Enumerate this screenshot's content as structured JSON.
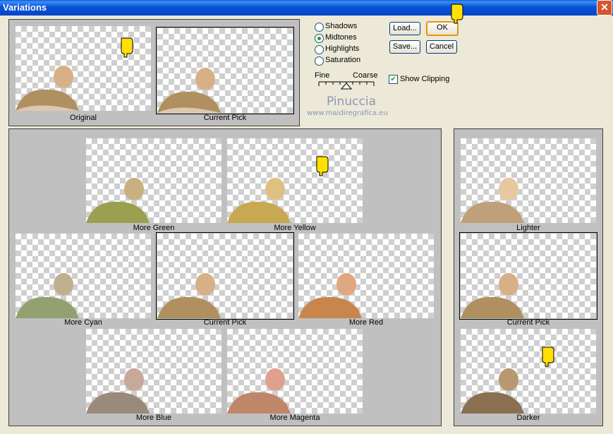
{
  "window": {
    "title": "Variations",
    "close_glyph": "✕"
  },
  "top_previews": [
    {
      "label": "Original",
      "selected": false
    },
    {
      "label": "Current Pick",
      "selected": true
    }
  ],
  "options": {
    "radios": [
      {
        "label": "Shadows",
        "checked": false
      },
      {
        "label": "Midtones",
        "checked": true
      },
      {
        "label": "Highlights",
        "checked": false
      },
      {
        "label": "Saturation",
        "checked": false
      }
    ],
    "slider": {
      "fine_label": "Fine",
      "coarse_label": "Coarse",
      "level": 0.5
    },
    "show_clipping": {
      "label": "Show Clipping",
      "checked": true
    }
  },
  "buttons": {
    "load": "Load...",
    "ok": "OK",
    "save": "Save...",
    "cancel": "Cancel"
  },
  "watermark": {
    "name": "Pinuccia",
    "url": "www.maidiregrafica.eu"
  },
  "color_variations": [
    {
      "label": "More Green",
      "tint": "#9aa050"
    },
    {
      "label": "More Yellow",
      "tint": "#c8a850"
    },
    {
      "label": "More Cyan",
      "tint": "#93a070"
    },
    {
      "label": "Current Pick",
      "tint": "#b09060",
      "selected": true
    },
    {
      "label": "More Red",
      "tint": "#c8864e"
    },
    {
      "label": "More Blue",
      "tint": "#9a8a7a"
    },
    {
      "label": "More Magenta",
      "tint": "#c0866a"
    }
  ],
  "brightness_variations": [
    {
      "label": "Lighter",
      "tint": "#c0a07a"
    },
    {
      "label": "Current Pick",
      "tint": "#b09060",
      "selected": true
    },
    {
      "label": "Darker",
      "tint": "#8a7050"
    }
  ],
  "colors": {
    "panel_bg": "#c0c0c0",
    "dialog_bg": "#ece9d8",
    "title_bar": "#0a5fd8",
    "ok_border": "#e59700",
    "hand_pointer": "#ffe000"
  }
}
